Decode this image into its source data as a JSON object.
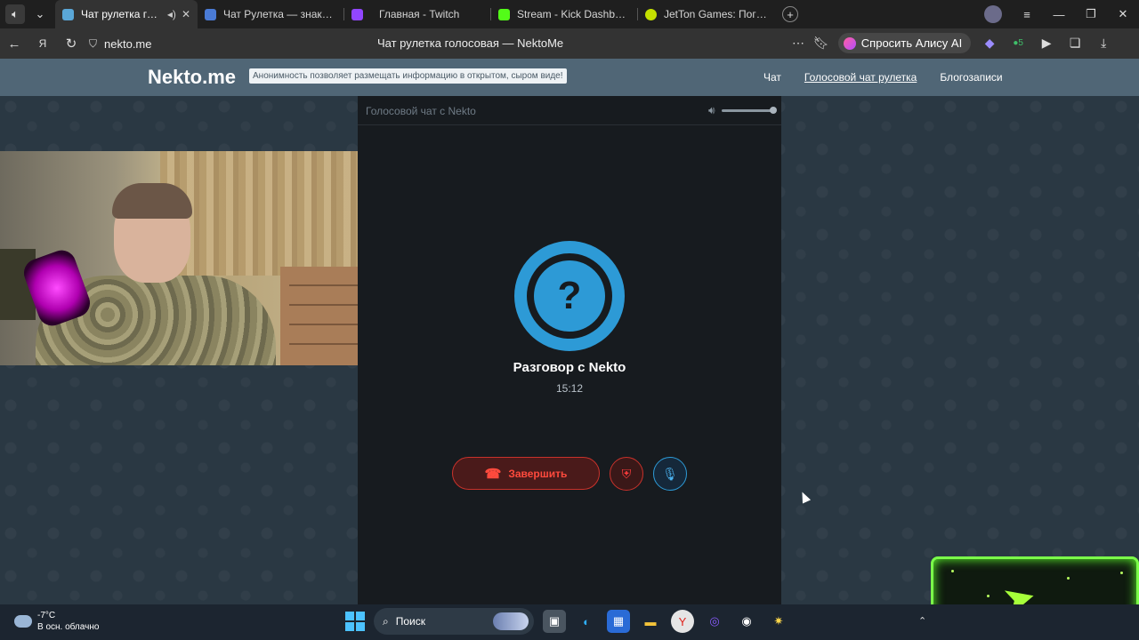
{
  "browser": {
    "tabs": [
      {
        "title": "Чат рулетка голосо",
        "active": true,
        "favicon_color": "#5aa7d8",
        "audio": true
      },
      {
        "title": "Чат Рулетка — знакомств",
        "active": false,
        "favicon_color": "#4a7bd6"
      },
      {
        "title": "Главная - Twitch",
        "active": false,
        "favicon_color": "#9146ff"
      },
      {
        "title": "Stream - Kick Dashboard",
        "active": false,
        "favicon_color": "#53fc18"
      },
      {
        "title": "JetTon Games: Погружен",
        "active": false,
        "favicon_color": "#c4e000"
      }
    ],
    "url": "nekto.me",
    "page_title": "Чат рулетка голосовая — NektoMe",
    "alice_label": "Спросить Алису AI",
    "extension_badge": "5"
  },
  "site": {
    "logo": "Nekto.me",
    "tagline": "Анонимность позволяет размещать информацию в открытом, сыром виде!",
    "nav": [
      "Чат",
      "Голосовой чат рулетка",
      "Блогозаписи"
    ]
  },
  "panel": {
    "title": "Голосовой чат с Nekto",
    "volume_level": 1.0,
    "avatar_symbol": "?",
    "conversation_title": "Разговор с Nekto",
    "timer": "15:12",
    "end_label": "Завершить",
    "accent": "#2d9ad6",
    "danger": "#c8322b"
  },
  "taskbar": {
    "temperature": "-7°C",
    "weather": "В осн. облачно",
    "search_placeholder": "Поиск"
  }
}
